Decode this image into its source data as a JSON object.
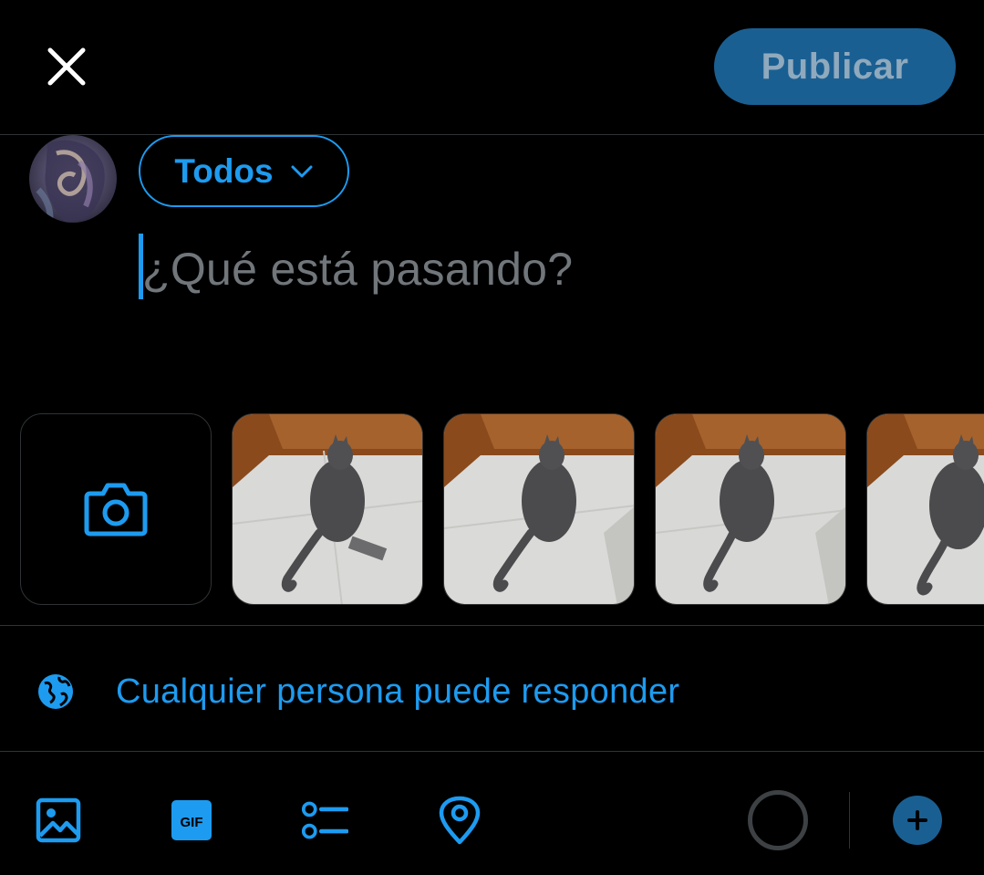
{
  "header": {
    "close_icon": "close-icon",
    "publish_label": "Publicar"
  },
  "composer": {
    "audience_label": "Todos",
    "placeholder": "¿Qué está pasando?"
  },
  "media": {
    "camera_icon": "camera-icon",
    "photos": [
      {
        "subject": "gray cat on tiled floor"
      },
      {
        "subject": "gray cat on tiled floor"
      },
      {
        "subject": "gray cat on tiled floor"
      },
      {
        "subject": "gray cat on tiled floor"
      }
    ]
  },
  "reply": {
    "icon": "globe-icon",
    "label": "Cualquier persona puede responder"
  },
  "toolbar": {
    "items": [
      "image-icon",
      "gif-icon",
      "poll-icon",
      "location-icon"
    ],
    "counter_icon": "character-counter",
    "add_icon": "plus-icon"
  },
  "colors": {
    "accent": "#1d9bf0",
    "publish_bg_disabled": "#1a5f92",
    "background": "#000000",
    "placeholder": "#71767b",
    "divider": "#2f3336"
  }
}
